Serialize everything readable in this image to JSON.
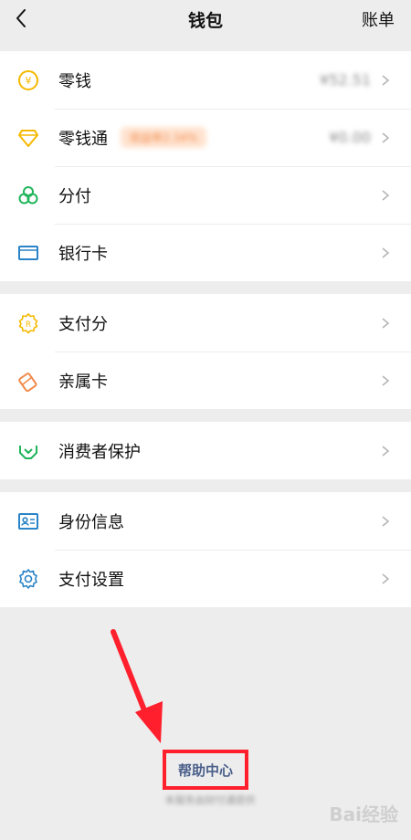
{
  "nav": {
    "title": "钱包",
    "right_action": "账单"
  },
  "groups": [
    {
      "items": [
        {
          "name": "零钱",
          "value": "¥52.51",
          "icon": "yuan-coin-icon"
        },
        {
          "name": "零钱通",
          "tag": "收益率2.34%",
          "value": "¥0.00",
          "icon": "diamond-icon"
        },
        {
          "name": "分付",
          "icon": "fenfu-icon"
        },
        {
          "name": "银行卡",
          "icon": "bank-card-icon"
        }
      ]
    },
    {
      "items": [
        {
          "name": "支付分",
          "icon": "pay-score-icon"
        },
        {
          "name": "亲属卡",
          "icon": "family-card-icon"
        }
      ]
    },
    {
      "items": [
        {
          "name": "消费者保护",
          "icon": "consumer-protection-icon"
        }
      ]
    },
    {
      "items": [
        {
          "name": "身份信息",
          "icon": "id-info-icon"
        },
        {
          "name": "支付设置",
          "icon": "gear-icon"
        }
      ]
    }
  ],
  "footer": {
    "help_center": "帮助中心",
    "help_sub": "本服务由财付通提供"
  },
  "watermark": "Bai经验",
  "colors": {
    "accent_yellow": "#f5b900",
    "accent_green": "#20b55b",
    "accent_blue": "#2a84c7",
    "accent_orange": "#f08a4b",
    "highlight_red": "#ff1f2d"
  }
}
